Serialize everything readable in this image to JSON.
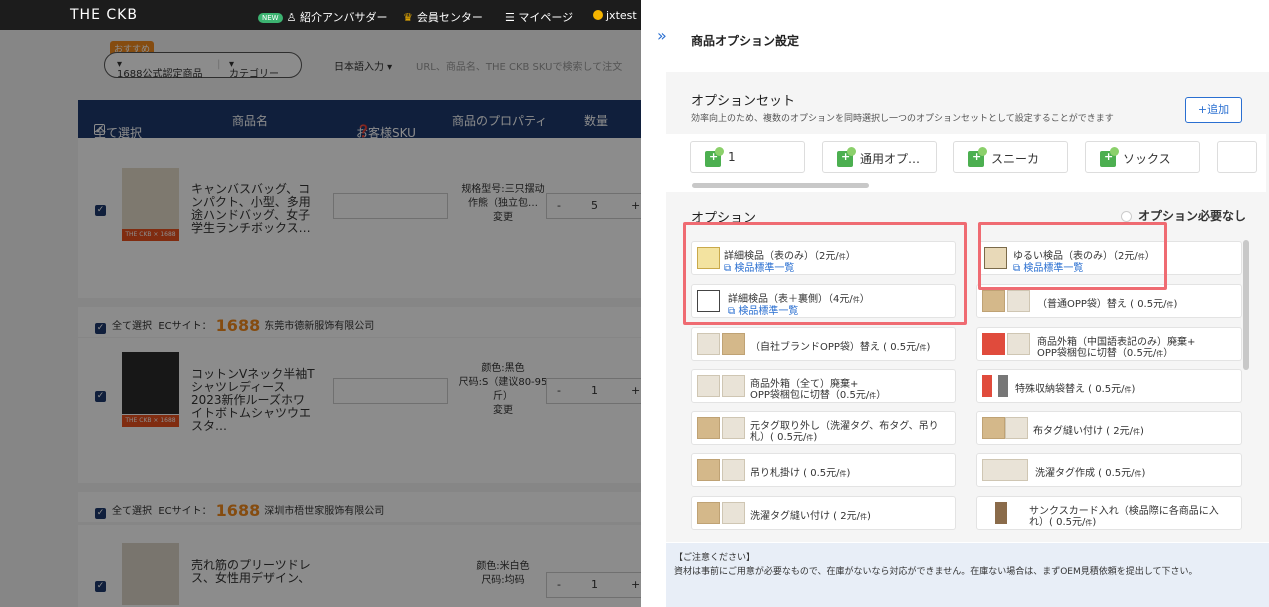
{
  "header": {
    "logo": "THE CKB",
    "nav": [
      {
        "badge": "NEW",
        "label": "紹介アンバサダー"
      },
      {
        "label": "会員センター"
      },
      {
        "label": "マイページ"
      },
      {
        "label": "jxtest"
      }
    ]
  },
  "search": {
    "badge": "おすすめ",
    "source": "1688公式認定商品",
    "category": "カテゴリー",
    "lang": "日本語入力",
    "placeholder": "URL、商品名、THE CKB SKUで検索して注文"
  },
  "table_header": {
    "select_all": "全て選択",
    "product_name": "商品名",
    "customer_sku": "お客様SKU",
    "properties": "商品のプロパティ",
    "quantity": "数量"
  },
  "products": [
    {
      "name": "キャンバスバッグ、コンパクト、小型、多用途ハンドバッグ、女子学生ランチボックス…",
      "prop1": "规格型号:三只摆动",
      "prop2": "作熊（独立包…",
      "change": "変更",
      "qty": "5",
      "tag": "THE CKB × 1688"
    },
    {
      "name": "コットンVネック半袖Tシャツレディース2023新作ルーズホワイトボトムシャツウエスタ…",
      "prop1": "颜色:黑色",
      "prop2": "尺码:S（建议80-95斤）",
      "change": "変更",
      "qty": "1",
      "tag": "THE CKB × 1688"
    },
    {
      "name": "売れ筋のプリーツドレス、女性用デザイン、",
      "prop1": "颜色:米白色",
      "prop2": "尺码:均码",
      "qty": "1"
    }
  ],
  "shops": [
    {
      "select_all": "全て選択",
      "ec": "ECサイト：",
      "brand": "1688",
      "name": "东莞市德新服饰有限公司"
    },
    {
      "select_all": "全て選択",
      "ec": "ECサイト：",
      "brand": "1688",
      "name": "深圳市梧世家服饰有限公司"
    }
  ],
  "drawer": {
    "title": "商品オプション設定",
    "option_set_title": "オプションセット",
    "option_set_desc": "効率向上のため、複数のオプションを同時選択し一つのオプションセットとして設定することができます",
    "add_label": "+追加",
    "sets": [
      "1",
      "通用オプ…",
      "スニーカ",
      "ソックス"
    ],
    "options_title": "オプション",
    "no_option_label": "オプション必要なし",
    "options": [
      {
        "text": "詳細検品（表のみ）（2元/",
        "unit": "件",
        "close": "）",
        "link": "検品標準一覧"
      },
      {
        "text": "ゆるい検品（表のみ）（2元/",
        "unit": "件",
        "close": "）",
        "link": "検品標準一覧"
      },
      {
        "text": "詳細検品（表＋裏側）（4元/",
        "unit": "件",
        "close": "）",
        "link": "検品標準一覧"
      },
      {
        "text": "（普通OPP袋）替え ( 0.5元/",
        "unit": "件",
        "close": ")"
      },
      {
        "text": "（自社ブランドOPP袋）替え ( 0.5元/",
        "unit": "件",
        "close": ")"
      },
      {
        "text": "商品外箱（中国語表記のみ）廃棄+",
        "text2": "OPP袋梱包に切替（0.5元/",
        "unit": "件",
        "close": "）"
      },
      {
        "text": "商品外箱（全て）廃棄+",
        "text2": "OPP袋梱包に切替（0.5元/",
        "unit": "件",
        "close": "）"
      },
      {
        "text": "特殊収納袋替え ( 0.5元/",
        "unit": "件",
        "close": ")"
      },
      {
        "text": "元タグ取り外し（洗濯タグ、布タグ、吊り",
        "text2": "札）( 0.5元/",
        "unit": "件",
        "close": ")"
      },
      {
        "text": "布タグ縫い付け ( 2元/",
        "unit": "件",
        "close": ")"
      },
      {
        "text": "吊り札掛け ( 0.5元/",
        "unit": "件",
        "close": ")"
      },
      {
        "text": "洗濯タグ作成 ( 0.5元/",
        "unit": "件",
        "close": ")"
      },
      {
        "text": "洗濯タグ縫い付け ( 2元/",
        "unit": "件",
        "close": ")"
      },
      {
        "text": "サンクスカード入れ（検品際に各商品に入",
        "text2": "れ）( 0.5元/",
        "unit": "件",
        "close": ")"
      }
    ],
    "notice_title": "【ご注意ください】",
    "notice_body": "資材は事前にご用意が必要なもので、在庫がないなら対応ができません。在庫ない場合は、まずOEM見積依頼を提出して下さい。"
  },
  "colors": {
    "accent": "#2a6fd1",
    "header_bg": "#1e3a6e",
    "highlight": "#ef6b72",
    "brand_orange": "#f38b1e"
  }
}
